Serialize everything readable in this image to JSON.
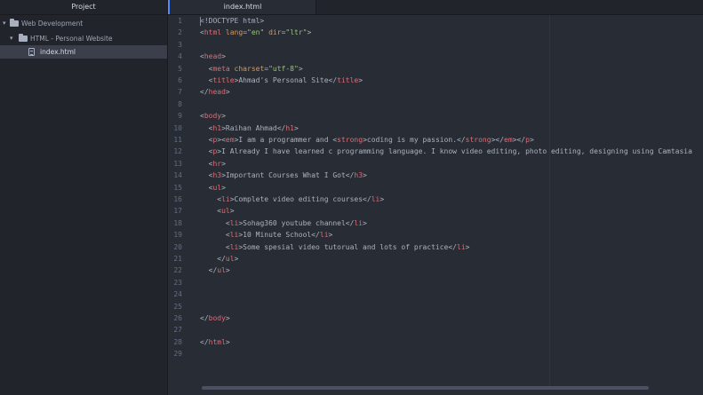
{
  "sidebar": {
    "title": "Project",
    "items": [
      {
        "label": "Web Development",
        "type": "folder",
        "depth": 0
      },
      {
        "label": "HTML - Personal Website",
        "type": "folder",
        "depth": 1
      },
      {
        "label": "index.html",
        "type": "file",
        "depth": 2
      }
    ]
  },
  "tabs": [
    {
      "label": "index.html",
      "active": true
    }
  ],
  "editor": {
    "line_numbers": [
      "1",
      "2",
      "3",
      "4",
      "5",
      "6",
      "7",
      "8",
      "9",
      "10",
      "11",
      "12",
      "13",
      "14",
      "15",
      "16",
      "17",
      "18",
      "19",
      "20",
      "21",
      "22",
      "23",
      "24",
      "25",
      "26",
      "27",
      "28",
      "29"
    ],
    "lines": [
      [
        [
          "<!DOCTYPE html>",
          "tx"
        ]
      ],
      [
        [
          "<",
          "tx"
        ],
        [
          "html",
          "tg"
        ],
        [
          " ",
          "tx"
        ],
        [
          "lang",
          "at"
        ],
        [
          "=",
          "tx"
        ],
        [
          "\"en\"",
          "st"
        ],
        [
          " ",
          "tx"
        ],
        [
          "dir",
          "at"
        ],
        [
          "=",
          "tx"
        ],
        [
          "\"ltr\"",
          "st"
        ],
        [
          ">",
          "tx"
        ]
      ],
      [],
      [
        [
          "<",
          "tx"
        ],
        [
          "head",
          "tg"
        ],
        [
          ">",
          "tx"
        ]
      ],
      [
        [
          "  <",
          "tx"
        ],
        [
          "meta",
          "tg"
        ],
        [
          " ",
          "tx"
        ],
        [
          "charset",
          "at"
        ],
        [
          "=",
          "tx"
        ],
        [
          "\"utf-8\"",
          "st"
        ],
        [
          ">",
          "tx"
        ]
      ],
      [
        [
          "  <",
          "tx"
        ],
        [
          "title",
          "tg"
        ],
        [
          ">Ahmad's Personal Site</",
          "tx"
        ],
        [
          "title",
          "tg"
        ],
        [
          ">",
          "tx"
        ]
      ],
      [
        [
          "</",
          "tx"
        ],
        [
          "head",
          "tg"
        ],
        [
          ">",
          "tx"
        ]
      ],
      [],
      [
        [
          "<",
          "tx"
        ],
        [
          "body",
          "tg"
        ],
        [
          ">",
          "tx"
        ]
      ],
      [
        [
          "  <",
          "tx"
        ],
        [
          "h1",
          "tg"
        ],
        [
          ">Raihan Ahmad</",
          "tx"
        ],
        [
          "h1",
          "tg"
        ],
        [
          ">",
          "tx"
        ]
      ],
      [
        [
          "  <",
          "tx"
        ],
        [
          "p",
          "tg"
        ],
        [
          "><",
          "tx"
        ],
        [
          "em",
          "tg"
        ],
        [
          ">I am a programmer and <",
          "tx"
        ],
        [
          "strong",
          "tg"
        ],
        [
          ">coding is my passion.</",
          "tx"
        ],
        [
          "strong",
          "tg"
        ],
        [
          "></",
          "tx"
        ],
        [
          "em",
          "tg"
        ],
        [
          "></",
          "tx"
        ],
        [
          "p",
          "tg"
        ],
        [
          ">",
          "tx"
        ]
      ],
      [
        [
          "  <",
          "tx"
        ],
        [
          "p",
          "tg"
        ],
        [
          ">I Already I have learned c programming language. I know video editing, photo editing, designing using Camtasia",
          "tx"
        ]
      ],
      [
        [
          "  <",
          "tx"
        ],
        [
          "hr",
          "tg"
        ],
        [
          ">",
          "tx"
        ]
      ],
      [
        [
          "  <",
          "tx"
        ],
        [
          "h3",
          "tg"
        ],
        [
          ">Important Courses What I Got</",
          "tx"
        ],
        [
          "h3",
          "tg"
        ],
        [
          ">",
          "tx"
        ]
      ],
      [
        [
          "  <",
          "tx"
        ],
        [
          "ul",
          "tg"
        ],
        [
          ">",
          "tx"
        ]
      ],
      [
        [
          "    <",
          "tx"
        ],
        [
          "li",
          "tg"
        ],
        [
          ">Complete video editing courses</",
          "tx"
        ],
        [
          "li",
          "tg"
        ],
        [
          ">",
          "tx"
        ]
      ],
      [
        [
          "    <",
          "tx"
        ],
        [
          "ul",
          "tg"
        ],
        [
          ">",
          "tx"
        ]
      ],
      [
        [
          "      <",
          "tx"
        ],
        [
          "li",
          "tg"
        ],
        [
          ">Sohag360 youtube channel</",
          "tx"
        ],
        [
          "li",
          "tg"
        ],
        [
          ">",
          "tx"
        ]
      ],
      [
        [
          "      <",
          "tx"
        ],
        [
          "li",
          "tg"
        ],
        [
          ">10 Minute School</",
          "tx"
        ],
        [
          "li",
          "tg"
        ],
        [
          ">",
          "tx"
        ]
      ],
      [
        [
          "      <",
          "tx"
        ],
        [
          "li",
          "tg"
        ],
        [
          ">Some spesial video tutorual and lots of practice</",
          "tx"
        ],
        [
          "li",
          "tg"
        ],
        [
          ">",
          "tx"
        ]
      ],
      [
        [
          "    </",
          "tx"
        ],
        [
          "ul",
          "tg"
        ],
        [
          ">",
          "tx"
        ]
      ],
      [
        [
          "  </",
          "tx"
        ],
        [
          "ul",
          "tg"
        ],
        [
          ">",
          "tx"
        ]
      ],
      [],
      [],
      [],
      [
        [
          "</",
          "tx"
        ],
        [
          "body",
          "tg"
        ],
        [
          ">",
          "tx"
        ]
      ],
      [],
      [
        [
          "</",
          "tx"
        ],
        [
          "html",
          "tg"
        ],
        [
          ">",
          "tx"
        ]
      ],
      []
    ]
  },
  "colors": {
    "background": "#282c34",
    "sidebar": "#21252b",
    "tag": "#e06c75",
    "attribute": "#d19a66",
    "string": "#98c379",
    "text": "#abb2bf",
    "cursor": "#528bff"
  }
}
